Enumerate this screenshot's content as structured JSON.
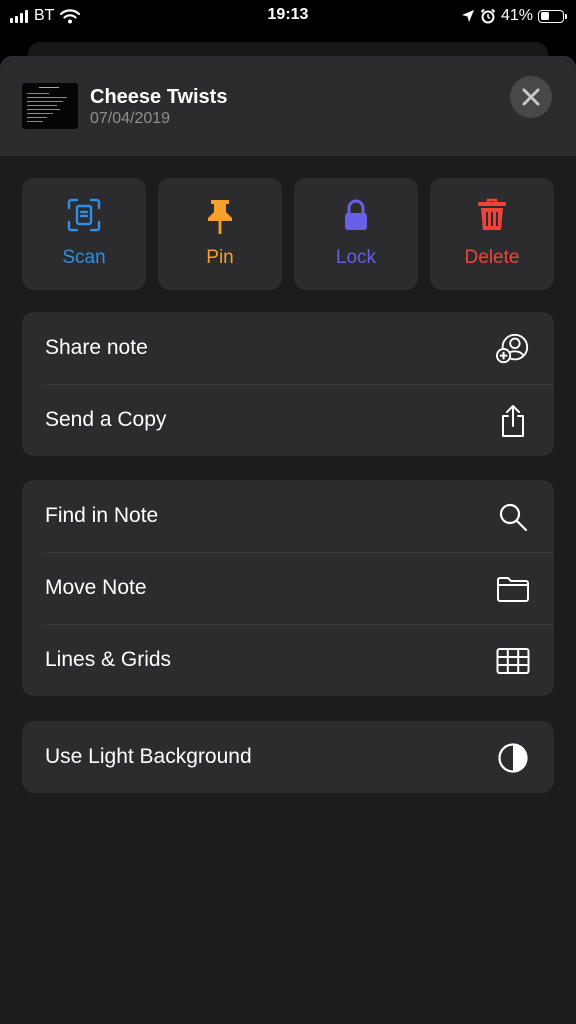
{
  "status_bar": {
    "carrier": "BT",
    "time": "19:13",
    "battery": "41%",
    "battery_level": 0.41,
    "icons": [
      "signal-bars-icon",
      "wifi-icon",
      "location-arrow-icon",
      "alarm-icon",
      "battery-icon"
    ]
  },
  "note": {
    "title": "Cheese Twists",
    "date": "07/04/2019",
    "close_icon": "close-icon"
  },
  "actions": [
    {
      "label": "Scan",
      "icon": "scan-document-icon",
      "color": "#2f8fe6"
    },
    {
      "label": "Pin",
      "icon": "pin-icon",
      "color": "#f5a02a"
    },
    {
      "label": "Lock",
      "icon": "lock-icon",
      "color": "#6a5fe8"
    },
    {
      "label": "Delete",
      "icon": "trash-icon",
      "color": "#f0443a"
    }
  ],
  "menu_groups": [
    {
      "items": [
        {
          "label": "Share note",
          "icon": "share-note-icon"
        },
        {
          "label": "Send a Copy",
          "icon": "share-icon"
        }
      ]
    },
    {
      "items": [
        {
          "label": "Find in Note",
          "icon": "magnifying-glass-icon"
        },
        {
          "label": "Move Note",
          "icon": "folder-icon"
        },
        {
          "label": "Lines & Grids",
          "icon": "grid-icon"
        }
      ]
    },
    {
      "items": [
        {
          "label": "Use Light Background",
          "icon": "contrast-icon"
        }
      ]
    }
  ],
  "colors": {
    "background": "#000000",
    "sheet": "#1c1c1e",
    "card": "#2c2c2e",
    "separator": "#3a3a3c",
    "secondary_text": "#8e8e93"
  }
}
